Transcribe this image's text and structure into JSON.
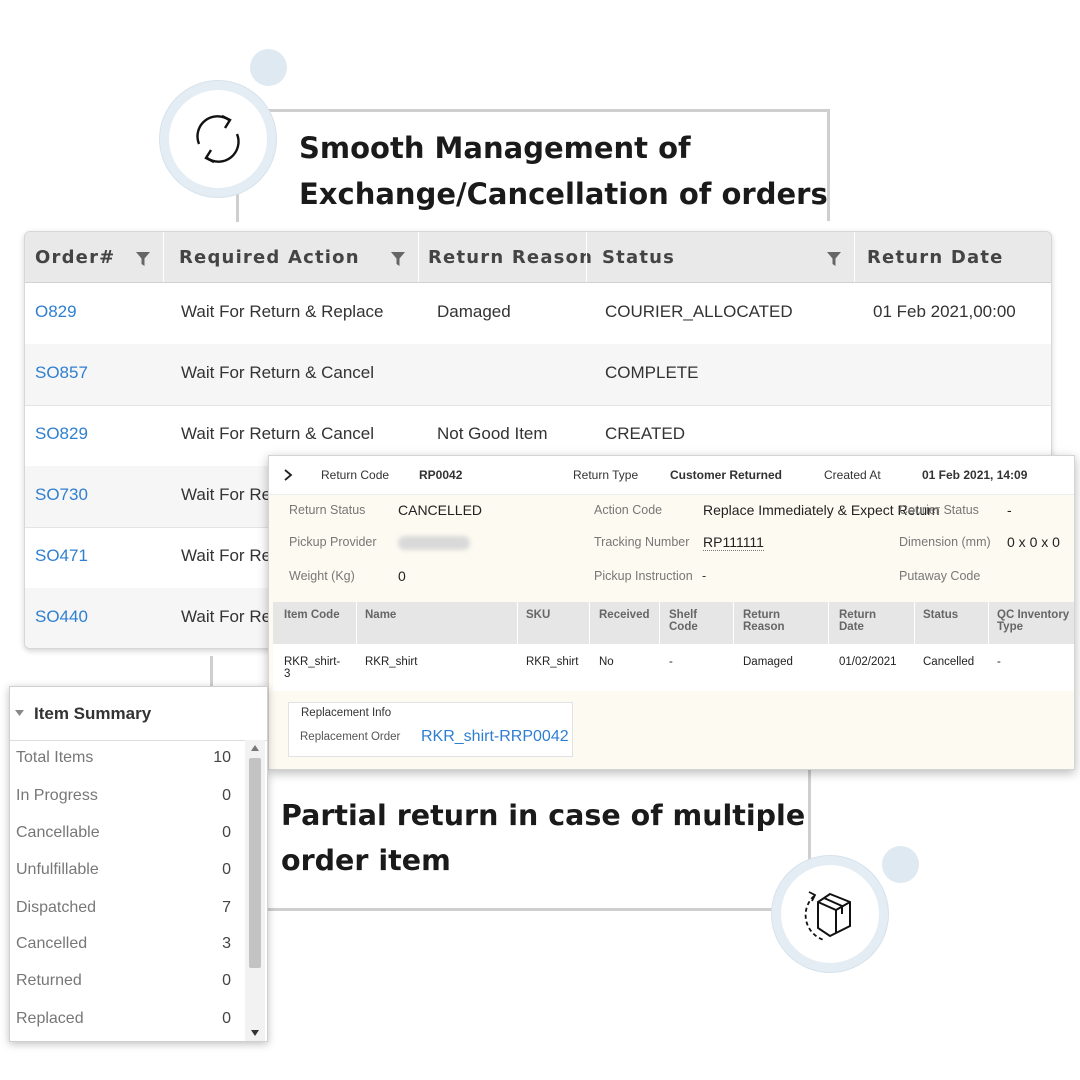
{
  "headline_top": {
    "line1": "Smooth Management of",
    "line2": "Exchange/Cancellation of orders",
    "icon": "refresh-icon"
  },
  "headline_bottom": {
    "line1": "Partial return in case of multiple",
    "line2": "order item",
    "icon": "box-return-icon"
  },
  "orders": {
    "columns": [
      "Order#",
      "Required Action",
      "Return Reason",
      "Status",
      "Return Date"
    ],
    "rows": [
      {
        "order": "O829",
        "action": "Wait For Return & Replace",
        "reason": "Damaged",
        "status": "COURIER_ALLOCATED",
        "date": "01 Feb 2021,00:00"
      },
      {
        "order": "SO857",
        "action": "Wait For Return & Cancel",
        "reason": "",
        "status": "COMPLETE",
        "date": ""
      },
      {
        "order": "SO829",
        "action": "Wait For Return & Cancel",
        "reason": "Not Good Item",
        "status": "CREATED",
        "date": ""
      },
      {
        "order": "SO730",
        "action": "Wait For Re",
        "reason": "",
        "status": "",
        "date": ""
      },
      {
        "order": "SO471",
        "action": "Wait For Re",
        "reason": "",
        "status": "",
        "date": ""
      },
      {
        "order": "SO440",
        "action": "Wait For Re",
        "reason": "",
        "status": "",
        "date": ""
      }
    ]
  },
  "return_detail": {
    "expand_icon": "chevron-right-icon",
    "return_code_label": "Return Code",
    "return_code": "RP0042",
    "return_type_label": "Return Type",
    "return_type": "Customer Returned",
    "created_at_label": "Created At",
    "created_at": "01 Feb 2021, 14:09",
    "return_status_label": "Return Status",
    "return_status": "CANCELLED",
    "action_code_label": "Action Code",
    "action_code": "Replace Immediately & Expect Return",
    "courier_status_label": "Courier Status",
    "courier_status": "-",
    "pickup_provider_label": "Pickup Provider",
    "tracking_number_label": "Tracking Number",
    "tracking_number": "RP111111",
    "dimension_label": "Dimension (mm)",
    "dimension": "0 x 0 x 0",
    "weight_label": "Weight (Kg)",
    "weight": "0",
    "pickup_instruction_label": "Pickup Instruction",
    "pickup_instruction": "-",
    "putaway_code_label": "Putaway Code",
    "items_columns": [
      "Item Code",
      "Name",
      "SKU",
      "Received",
      "Shelf Code",
      "Return Reason",
      "Return Date",
      "Status",
      "QC Inventory Type"
    ],
    "items_rows": [
      {
        "item_code": "RKR_shirt-3",
        "name": "RKR_shirt",
        "sku": "RKR_shirt",
        "received": "No",
        "shelf_code": "-",
        "reason": "Damaged",
        "date": "01/02/2021",
        "status": "Cancelled",
        "qc": "-"
      }
    ],
    "replacement_info_label": "Replacement Info",
    "replacement_order_label": "Replacement Order",
    "replacement_order": "RKR_shirt-RRP0042"
  },
  "item_summary": {
    "title": "Item Summary",
    "rows": [
      {
        "label": "Total Items",
        "value": "10"
      },
      {
        "label": "In Progress",
        "value": "0"
      },
      {
        "label": "Cancellable",
        "value": "0"
      },
      {
        "label": "Unfulfillable",
        "value": "0"
      },
      {
        "label": "Dispatched",
        "value": "7"
      },
      {
        "label": "Cancelled",
        "value": "3"
      },
      {
        "label": "Returned",
        "value": "0"
      },
      {
        "label": "Replaced",
        "value": "0"
      }
    ]
  },
  "colors": {
    "link": "#2f7fd1",
    "header_bg": "#e9e9e9",
    "detail_bg": "#fdfaf1",
    "circle_ring": "#e4edf4"
  }
}
